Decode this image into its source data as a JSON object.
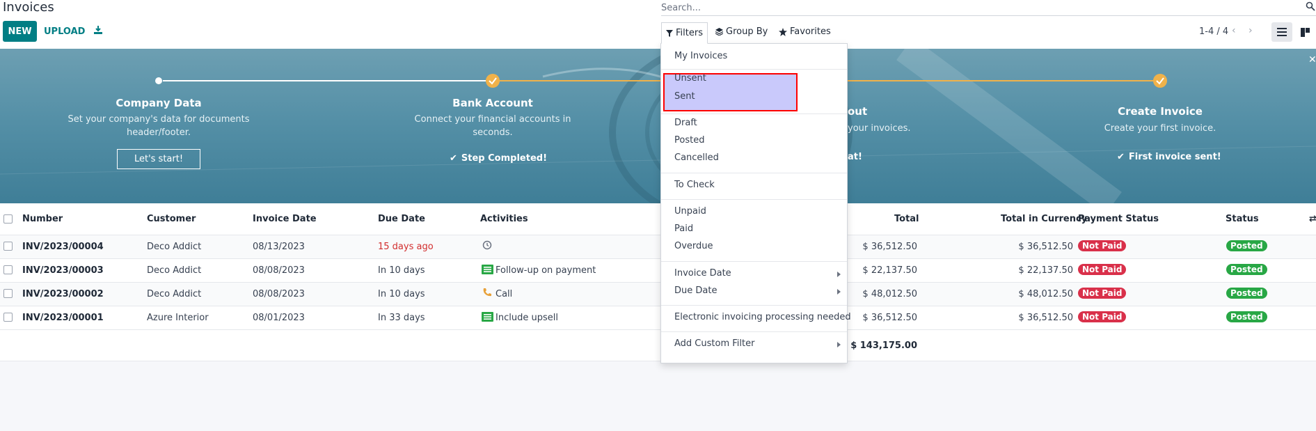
{
  "header": {
    "title": "Invoices",
    "new_label": "NEW",
    "upload_label": "UPLOAD",
    "search_placeholder": "Search...",
    "filters_label": "Filters",
    "groupby_label": "Group By",
    "favorites_label": "Favorites",
    "pager": "1-4 / 4"
  },
  "banner": {
    "steps": [
      {
        "title": "Company Data",
        "desc1": "Set your company's data for documents",
        "desc2": "header/footer.",
        "action": "Let's start!"
      },
      {
        "title": "Bank Account",
        "desc1": "Connect your financial accounts in",
        "desc2": "seconds.",
        "done": "Step Completed!"
      },
      {
        "title": "out",
        "desc1": "your invoices.",
        "done": "at!"
      },
      {
        "title": "Create Invoice",
        "desc1": "Create your first invoice.",
        "done": "First invoice sent!"
      }
    ]
  },
  "table": {
    "headers": {
      "number": "Number",
      "customer": "Customer",
      "invoice_date": "Invoice Date",
      "due_date": "Due Date",
      "activities": "Activities",
      "total": "Total",
      "total_currency": "Total in Currency",
      "payment_status": "Payment Status",
      "status": "Status"
    },
    "rows": [
      {
        "number": "INV/2023/00004",
        "customer": "Deco Addict",
        "invoice_date": "08/13/2023",
        "due_date": "15 days ago",
        "activity": "",
        "activity_icon": "clock-icon",
        "total": "$ 36,512.50",
        "total_currency": "$ 36,512.50",
        "payment_status": "Not Paid",
        "status": "Posted"
      },
      {
        "number": "INV/2023/00003",
        "customer": "Deco Addict",
        "invoice_date": "08/08/2023",
        "due_date": "In 10 days",
        "activity": "Follow-up on payment",
        "activity_icon": "todo-list-icon",
        "total": "$ 22,137.50",
        "total_currency": "$ 22,137.50",
        "payment_status": "Not Paid",
        "status": "Posted"
      },
      {
        "number": "INV/2023/00002",
        "customer": "Deco Addict",
        "invoice_date": "08/08/2023",
        "due_date": "In 10 days",
        "activity": "Call",
        "activity_icon": "phone-icon",
        "total": "$ 48,012.50",
        "total_currency": "$ 48,012.50",
        "payment_status": "Not Paid",
        "status": "Posted"
      },
      {
        "number": "INV/2023/00001",
        "customer": "Azure Interior",
        "invoice_date": "08/01/2023",
        "due_date": "In 33 days",
        "activity": "Include upsell",
        "activity_icon": "todo-list-icon",
        "total": "$ 36,512.50",
        "total_currency": "$ 36,512.50",
        "payment_status": "Not Paid",
        "status": "Posted"
      }
    ],
    "grand_total": "$ 143,175.00"
  },
  "filters_menu": {
    "my_invoices": "My Invoices",
    "unsent": "Unsent",
    "sent": "Sent",
    "draft": "Draft",
    "posted": "Posted",
    "cancelled": "Cancelled",
    "to_check": "To Check",
    "unpaid": "Unpaid",
    "paid": "Paid",
    "overdue": "Overdue",
    "invoice_date": "Invoice Date",
    "due_date": "Due Date",
    "einvoicing": "Electronic invoicing processing needed",
    "custom_filter": "Add Custom Filter"
  },
  "colors": {
    "primary": "#017e84",
    "highlight_fill": "#c9c9fb",
    "highlight_border": "#ff0000",
    "not_paid": "#d9304a",
    "posted": "#28a745",
    "overdue_text": "#d22d2d",
    "progress": "#f0b24a"
  }
}
